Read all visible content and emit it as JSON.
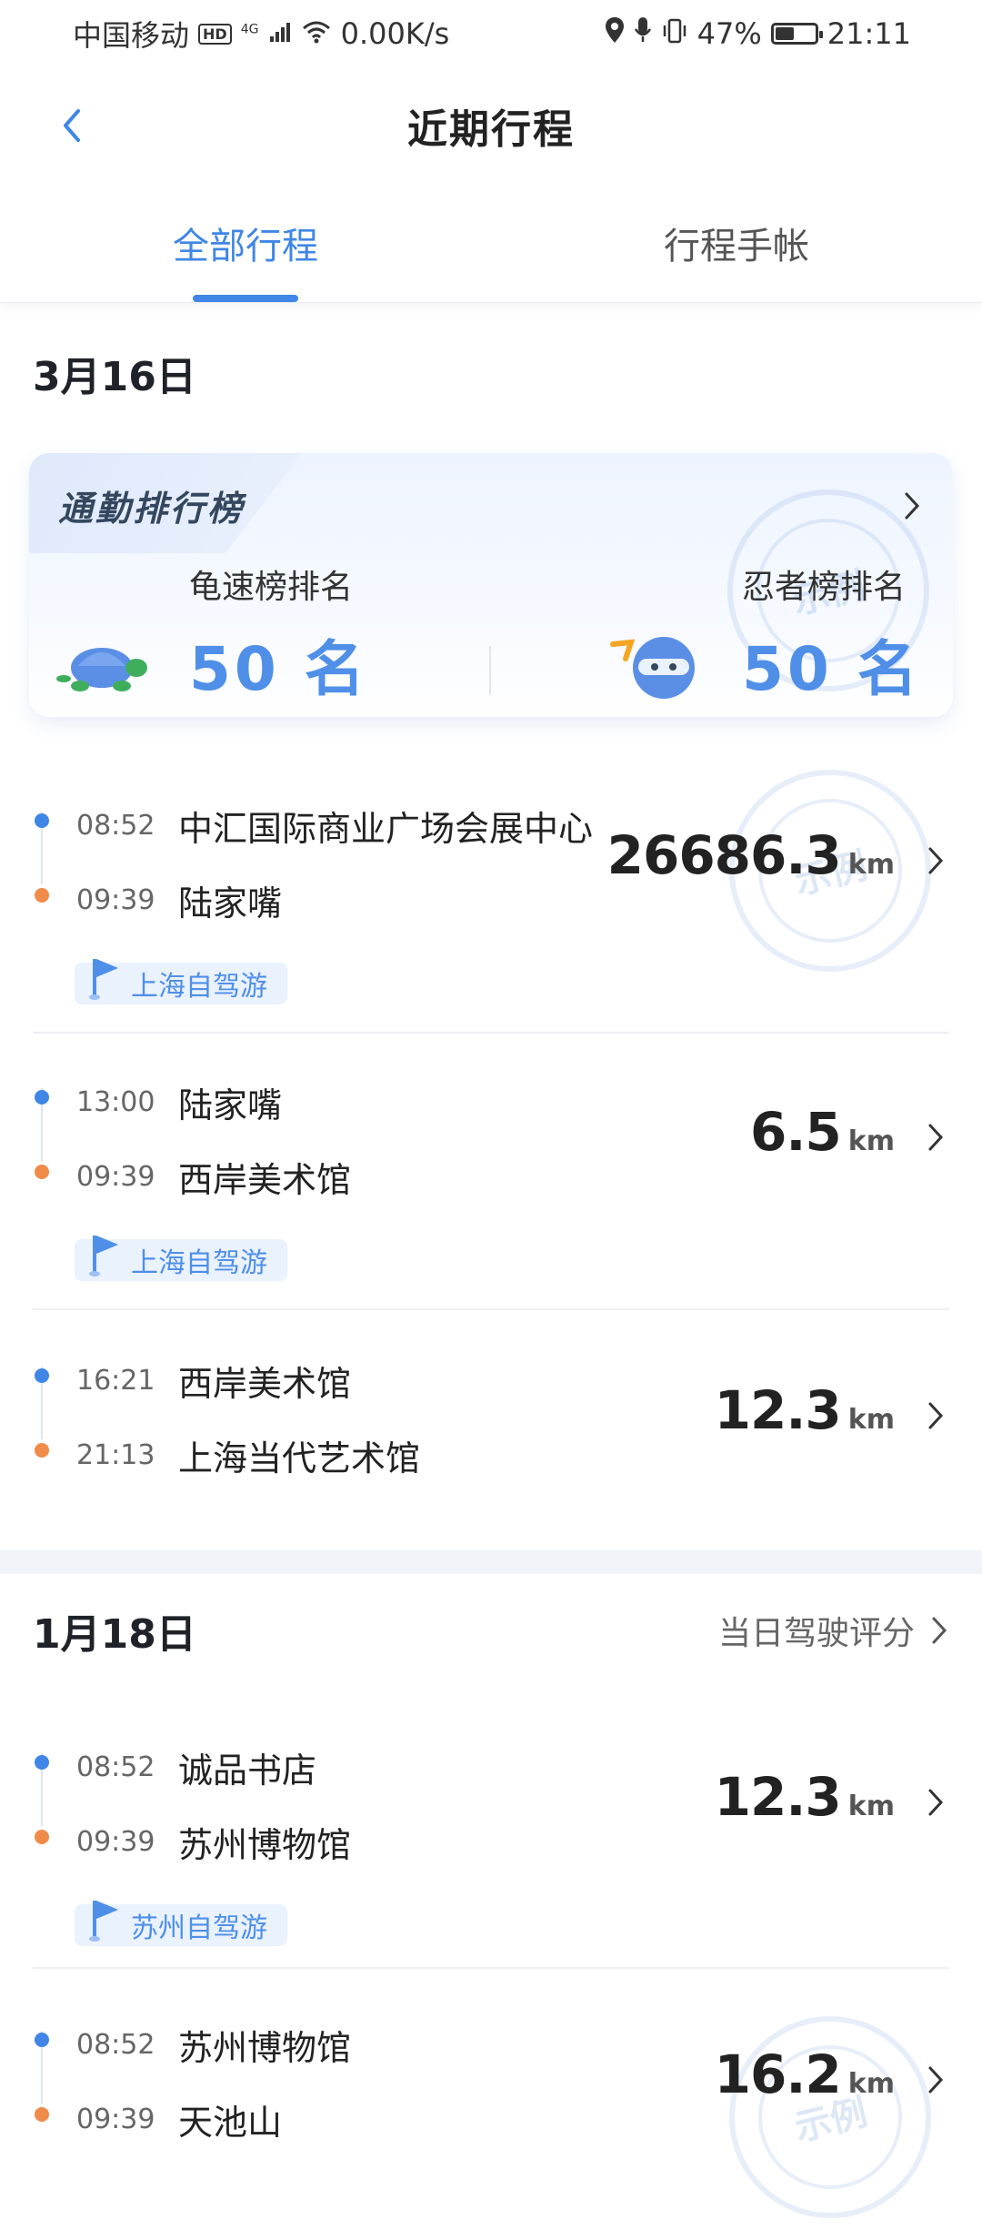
{
  "status_bar": {
    "carrier": "中国移动",
    "hd_badge": "HD",
    "network": "4G",
    "speed": "0.00K/s",
    "battery": "47%",
    "time": "21:11"
  },
  "nav": {
    "title": "近期行程"
  },
  "tabs": [
    {
      "label": "全部行程",
      "active": true
    },
    {
      "label": "行程手帐",
      "active": false
    }
  ],
  "sections": [
    {
      "date": "3月16日",
      "rank_card": {
        "title": "通勤排行榜",
        "left_label": "龟速榜排名",
        "left_value": "50 名",
        "right_label": "忍者榜排名",
        "right_value": "50 名"
      },
      "trips": [
        {
          "start_time": "08:52",
          "start_place": "中汇国际商业广场会展中心",
          "end_time": "09:39",
          "end_place": "陆家嘴",
          "distance": "26686.3",
          "unit": "km",
          "tag": "上海自驾游"
        },
        {
          "start_time": "13:00",
          "start_place": "陆家嘴",
          "end_time": "09:39",
          "end_place": "西岸美术馆",
          "distance": "6.5",
          "unit": "km",
          "tag": "上海自驾游"
        },
        {
          "start_time": "16:21",
          "start_place": "西岸美术馆",
          "end_time": "21:13",
          "end_place": "上海当代艺术馆",
          "distance": "12.3",
          "unit": "km",
          "tag": ""
        }
      ]
    },
    {
      "date": "1月18日",
      "score_link": "当日驾驶评分",
      "trips": [
        {
          "start_time": "08:52",
          "start_place": "诚品书店",
          "end_time": "09:39",
          "end_place": "苏州博物馆",
          "distance": "12.3",
          "unit": "km",
          "tag": "苏州自驾游"
        },
        {
          "start_time": "08:52",
          "start_place": "苏州博物馆",
          "end_time": "09:39",
          "end_place": "天池山",
          "distance": "16.2",
          "unit": "km",
          "tag": ""
        }
      ]
    }
  ],
  "colors": {
    "accent": "#3f86e6",
    "start_dot": "#3f86e6",
    "end_dot": "#f08b4a",
    "tag_bg": "#eaf2fe"
  },
  "icons": [
    "back-chevron-icon",
    "location-icon",
    "microphone-icon",
    "vibrate-icon",
    "wifi-icon",
    "signal-icon",
    "battery-icon",
    "chevron-right-icon",
    "turtle-icon",
    "ninja-icon",
    "flag-icon",
    "stamp-watermark"
  ]
}
